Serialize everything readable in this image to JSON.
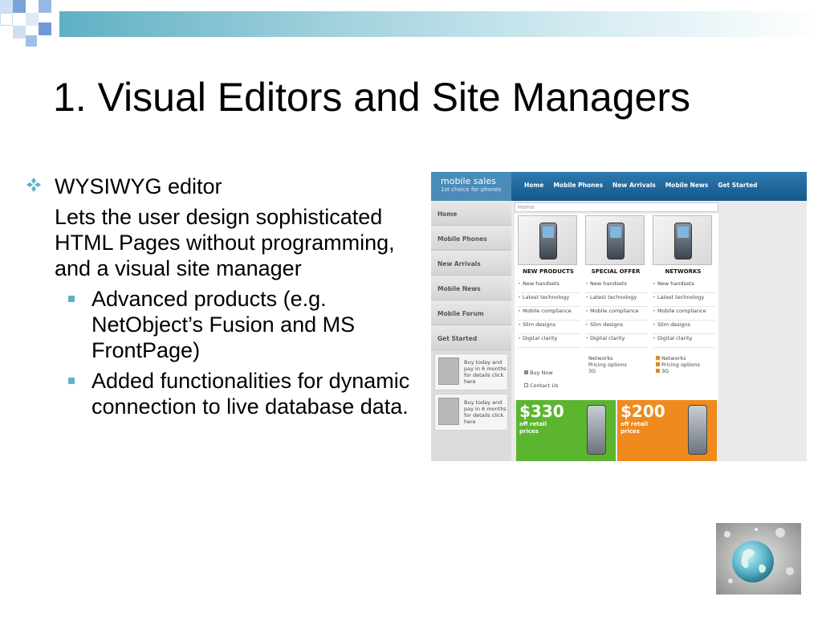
{
  "slide": {
    "title": "1. Visual Editors and Site Managers",
    "bullets": [
      {
        "text": "WYSIWYG editor",
        "paragraph": "Lets the user design sophisticated HTML Pages without programming, and a visual site manager",
        "subitems": [
          "Advanced products (e.g. NetObject’s Fusion and MS FrontPage)",
          "Added functionalities for dynamic connection to live database data."
        ]
      }
    ]
  },
  "website": {
    "logo": "mobile sales",
    "tagline": "1st choice for phones",
    "nav": [
      "Home",
      "Mobile Phones",
      "New Arrivals",
      "Mobile News",
      "Get Started"
    ],
    "breadcrumb": "Home",
    "sidebar": [
      "Home",
      "Mobile Phones",
      "New Arrivals",
      "Mobile News",
      "Mobile Forum",
      "Get Started"
    ],
    "promos": [
      "Buy today and pay in 6 months for details click here",
      "Buy today and pay in 6 months for details click here"
    ],
    "columns": [
      {
        "heading": "NEW PRODUCTS",
        "items": [
          "New handsets",
          "Latest technology",
          "Mobile compliance",
          "Slim designs",
          "Digital clarity"
        ],
        "extras": [
          "Buy Now",
          "Contact Us"
        ]
      },
      {
        "heading": "SPECIAL OFFER",
        "items": [
          "New handsets",
          "Latest technology",
          "Mobile compliance",
          "Slim designs",
          "Digital clarity"
        ],
        "extras": [
          "Networks",
          "Pricing options",
          "3G"
        ]
      },
      {
        "heading": "NETWORKS",
        "items": [
          "New handsets",
          "Latest technology",
          "Mobile compliance",
          "Slim designs",
          "Digital clarity"
        ],
        "extras": [
          "Networks",
          "Pricing options",
          "3G"
        ]
      }
    ],
    "banners": [
      {
        "price": "$330",
        "line1": "off retail",
        "line2": "prices",
        "color": "#5cb52f"
      },
      {
        "price": "$200",
        "line1": "off retail",
        "line2": "prices",
        "color": "#f08a1c"
      }
    ]
  },
  "colors": {
    "accent": "#5ab5c8",
    "nav_blue": "#1e6aa0"
  },
  "icons": {
    "level1_bullet": "four-diamond-bullet-icon",
    "level2_bullet": "square-bullet-icon",
    "corner_image": "globe-image"
  }
}
